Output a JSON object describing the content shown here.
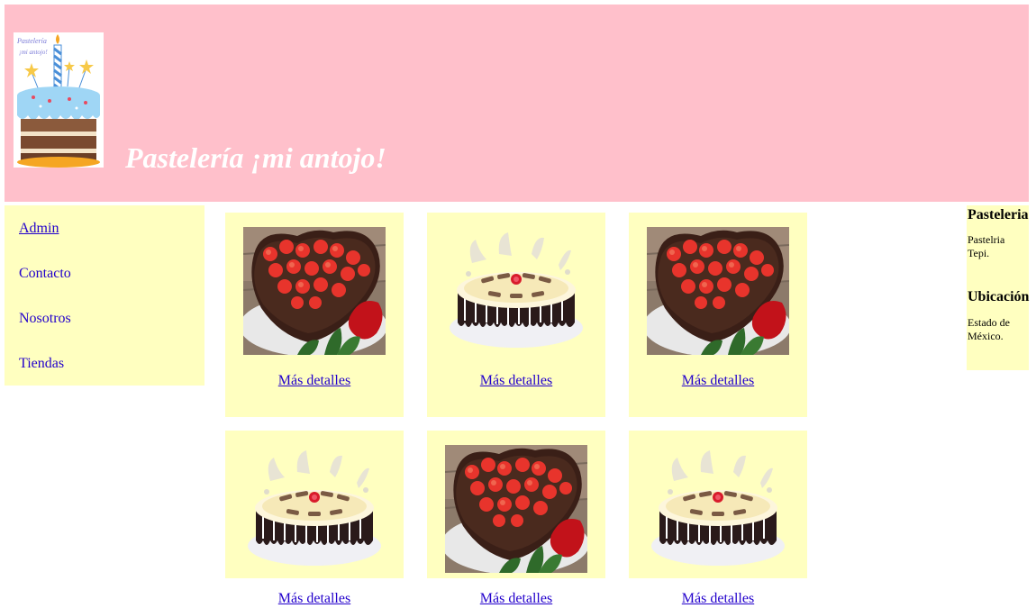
{
  "header": {
    "title": "Pastelería ¡mi antojo!",
    "logo_caption": "Pastelería ¡mi antojo!"
  },
  "nav": {
    "items": [
      {
        "label": "Admin"
      },
      {
        "label": "Contacto"
      },
      {
        "label": "Nosotros"
      },
      {
        "label": "Tiendas"
      }
    ]
  },
  "products": [
    {
      "image": "strawberry-heart-cake",
      "link_label": "Más detalles"
    },
    {
      "image": "cream-crown-cake",
      "link_label": "Más detalles"
    },
    {
      "image": "strawberry-heart-cake",
      "link_label": "Más detalles"
    },
    {
      "image": "cream-crown-cake",
      "link_label": "Más detalles"
    },
    {
      "image": "strawberry-heart-cake",
      "link_label": "Más detalles"
    },
    {
      "image": "cream-crown-cake",
      "link_label": "Más detalles"
    }
  ],
  "aside": {
    "heading1": "Pasteleria",
    "text1": "Pastelria Tepi.",
    "heading2": "Ubicación",
    "text2": "Estado de México."
  },
  "colors": {
    "header_bg": "#ffc0cb",
    "panel_bg": "#ffffc0",
    "link": "#2200cc"
  }
}
